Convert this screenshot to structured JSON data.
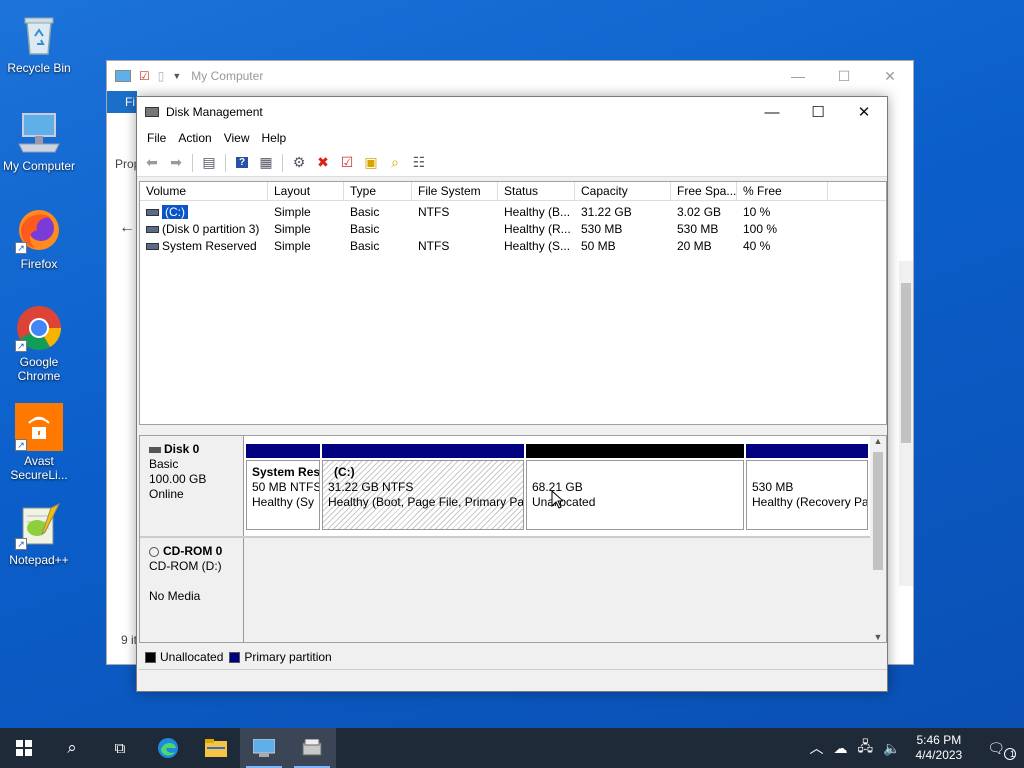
{
  "desktop": {
    "icons": [
      {
        "label": "Recycle Bin"
      },
      {
        "label": "My Computer"
      },
      {
        "label": "Firefox"
      },
      {
        "label": "Google Chrome"
      },
      {
        "label": "Avast SecureLi..."
      },
      {
        "label": "Notepad++"
      }
    ]
  },
  "explorer": {
    "title": "My Computer",
    "ribbon_tab": "Fi",
    "side_prop": "Prop",
    "items_count": "9 it"
  },
  "disk_management": {
    "title": "Disk Management",
    "menu": [
      "File",
      "Action",
      "View",
      "Help"
    ],
    "columns": [
      "Volume",
      "Layout",
      "Type",
      "File System",
      "Status",
      "Capacity",
      "Free Spa...",
      "% Free"
    ],
    "volumes": [
      {
        "volume": "(C:)",
        "layout": "Simple",
        "type": "Basic",
        "fs": "NTFS",
        "status": "Healthy (B...",
        "capacity": "31.22 GB",
        "free": "3.02 GB",
        "pct": "10 %"
      },
      {
        "volume": "(Disk 0 partition 3)",
        "layout": "Simple",
        "type": "Basic",
        "fs": "",
        "status": "Healthy (R...",
        "capacity": "530 MB",
        "free": "530 MB",
        "pct": "100 %"
      },
      {
        "volume": "System Reserved",
        "layout": "Simple",
        "type": "Basic",
        "fs": "NTFS",
        "status": "Healthy (S...",
        "capacity": "50 MB",
        "free": "20 MB",
        "pct": "40 %"
      }
    ],
    "disk0": {
      "name": "Disk 0",
      "type": "Basic",
      "size": "100.00 GB",
      "state": "Online",
      "partitions": [
        {
          "name": "System Res",
          "size": "50 MB NTFS",
          "status": "Healthy (Sy",
          "bar_color": "#000080"
        },
        {
          "name": "(C:)",
          "size": "31.22 GB NTFS",
          "status": "Healthy (Boot, Page File, Primary Pa",
          "bar_color": "#000080"
        },
        {
          "name": "",
          "size": "68.21 GB",
          "status": "Unallocated",
          "bar_color": "#000000"
        },
        {
          "name": "",
          "size": "530 MB",
          "status": "Healthy (Recovery Pa",
          "bar_color": "#000080"
        }
      ]
    },
    "cdrom": {
      "name": "CD-ROM 0",
      "drive": "CD-ROM (D:)",
      "media": "No Media"
    },
    "legend": {
      "unallocated": "Unallocated",
      "primary": "Primary partition",
      "unallocated_color": "#000000",
      "primary_color": "#000080"
    }
  },
  "taskbar": {
    "time": "5:46 PM",
    "date": "4/4/2023",
    "notifications": "1"
  }
}
